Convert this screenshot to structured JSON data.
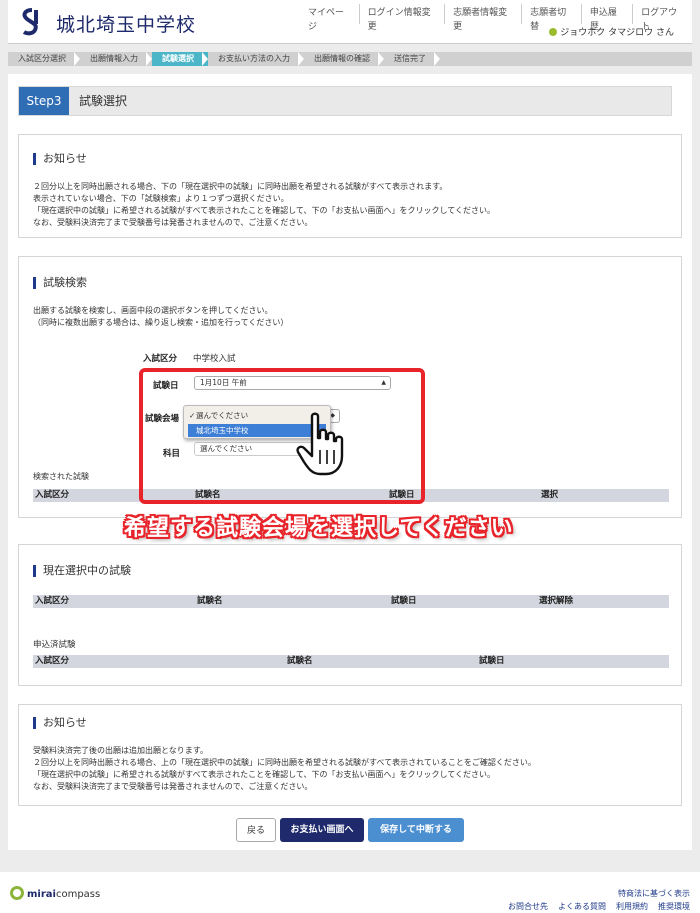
{
  "header": {
    "school_name": "城北埼玉中学校",
    "nav": [
      "マイページ",
      "ログイン情報変更",
      "志願者情報変更",
      "志願者切替",
      "申込履歴",
      "ログアウト"
    ],
    "username": "ジョウホク タマジロウ さん"
  },
  "steps": [
    "入試区分選択",
    "出願情報入力",
    "試験選択",
    "お支払い方法の入力",
    "出願情報の確認",
    "送信完了"
  ],
  "active_step_index": 2,
  "step_title": {
    "badge": "Step3",
    "label": "試験選択"
  },
  "notice1": {
    "title": "お知らせ",
    "lines": [
      "２回分以上を同時出願される場合、下の「現在選択中の試験」に同時出願を希望される試験がすべて表示されます。",
      "表示されていない場合、下の「試験検索」より１つずつ選択ください。",
      "「現在選択中の試験」に希望される試験がすべて表示されたことを確認して、下の「お支払い画面へ」をクリックしてください。",
      "なお、受験料決済完了まで受験番号は発番されませんので、ご注意ください。"
    ]
  },
  "search": {
    "title": "試験検索",
    "lines": [
      "出願する試験を検索し、画面中段の選択ボタンを押してください。",
      "（同時に複数出願する場合は、繰り返し検索・追加を行ってください）"
    ],
    "category_label": "入試区分",
    "category_value": "中学校入試",
    "date_label": "試験日",
    "date_value": "1月10日 午前",
    "venue_label": "試験会場",
    "venue_options": [
      "選んでください",
      "城北埼玉中学校"
    ],
    "subject_label": "科目",
    "subject_value": "選んでください",
    "results_label": "検索された試験",
    "columns": [
      "入試区分",
      "試験名",
      "試験日",
      "選択"
    ]
  },
  "overlay": {
    "caption": "希望する試験会場を選択してください"
  },
  "selected": {
    "title": "現在選択中の試験",
    "columns": [
      "入試区分",
      "試験名",
      "試験日",
      "選択解除"
    ],
    "applied_label": "申込済試験",
    "applied_columns": [
      "入試区分",
      "試験名",
      "試験日"
    ]
  },
  "notice2": {
    "title": "お知らせ",
    "lines": [
      "受験料決済完了後の出願は追加出願となります。",
      "２回分以上を同時出願される場合、上の「現在選択中の試験」に同時出願を希望される試験がすべて表示されていることをご確認ください。",
      "「現在選択中の試験」に希望される試験がすべて表示されたことを確認して、下の「お支払い画面へ」をクリックしてください。",
      "なお、受験料決済完了まで受験番号は発番されませんので、ご注意ください。"
    ]
  },
  "buttons": {
    "back": "戻る",
    "pay": "お支払い画面へ",
    "save": "保存して中断する"
  },
  "footer": {
    "logo_bold": "mirai",
    "logo_rest": "compass",
    "link_top": "特商法に基づく表示",
    "links_bottom": [
      "お問合せ先",
      "よくある質問",
      "利用規約",
      "推奨環境"
    ]
  },
  "colors": {
    "accent": "#4bb6c8",
    "navy": "#1e2a6b",
    "highlight": "#e8242a"
  }
}
